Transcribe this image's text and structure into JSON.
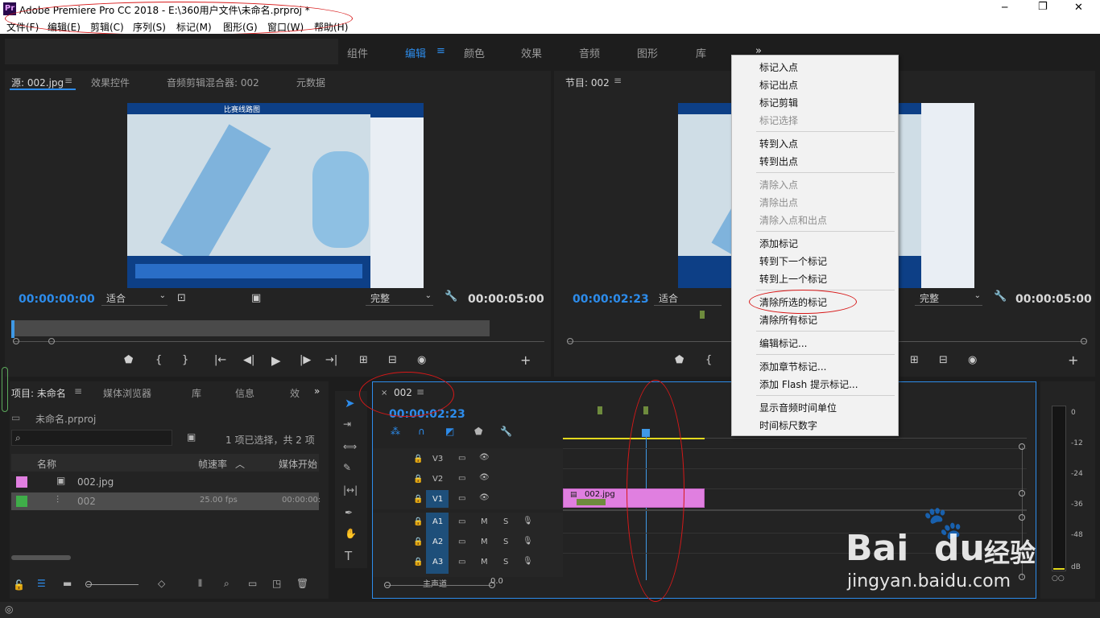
{
  "app": {
    "title": "Adobe Premiere Pro CC 2018 - E:\\360用户文件\\未命名.prproj *",
    "icon_text": "Pr"
  },
  "window_controls": {
    "minimize": "─",
    "restore": "❐",
    "close": "✕"
  },
  "menu": [
    "文件(F)",
    "编辑(E)",
    "剪辑(C)",
    "序列(S)",
    "标记(M)",
    "图形(G)",
    "窗口(W)",
    "帮助(H)"
  ],
  "workspaces": {
    "items": [
      "组件",
      "编辑",
      "颜色",
      "效果",
      "音频",
      "图形",
      "库"
    ],
    "active": "编辑",
    "more": "»"
  },
  "source_panel": {
    "tabs": [
      "源: 002.jpg",
      "效果控件",
      "音频剪辑混合器: 002",
      "元数据"
    ],
    "timecode": "00:00:00:00",
    "fit": "适合",
    "quality": "完整",
    "duration": "00:00:05:00"
  },
  "program_panel": {
    "tab": "节目: 002",
    "timecode": "00:00:02:23",
    "fit": "适合",
    "quality": "完整",
    "duration": "00:00:05:00"
  },
  "map_image": {
    "header_title": "比赛线路图"
  },
  "project_panel": {
    "tabs": [
      "项目: 未命名",
      "媒体浏览器",
      "库",
      "信息",
      "效"
    ],
    "file": "未命名.prproj",
    "selection": "1 项已选择，共 2 项",
    "columns": [
      "名称",
      "帧速率",
      "媒体开始"
    ],
    "items": [
      {
        "name": "002.jpg",
        "fps": "",
        "start": "",
        "color": "#e07fe0"
      },
      {
        "name": "002",
        "fps": "25.00 fps",
        "start": "00:00:00:",
        "color": "#3fae49"
      }
    ]
  },
  "timeline": {
    "tab": "002",
    "timecode": "00:00:02:23",
    "video_tracks": [
      "V3",
      "V2",
      "V1"
    ],
    "audio_tracks": [
      "A1",
      "A2",
      "A3"
    ],
    "master": "主声道",
    "master_value": "0.0",
    "clip_name": "002.jpg",
    "track_buttons": {
      "mute": "M",
      "solo": "S"
    }
  },
  "meter": {
    "labels": [
      "0",
      "-12",
      "-24",
      "-36",
      "-48",
      "dB"
    ]
  },
  "context_menu": {
    "items": [
      {
        "label": "标记入点",
        "enabled": true
      },
      {
        "label": "标记出点",
        "enabled": true
      },
      {
        "label": "标记剪辑",
        "enabled": true
      },
      {
        "label": "标记选择",
        "enabled": false
      },
      {
        "label": "转到入点",
        "enabled": true
      },
      {
        "label": "转到出点",
        "enabled": true
      },
      {
        "label": "清除入点",
        "enabled": false
      },
      {
        "label": "清除出点",
        "enabled": false
      },
      {
        "label": "清除入点和出点",
        "enabled": false
      },
      {
        "label": "添加标记",
        "enabled": true
      },
      {
        "label": "转到下一个标记",
        "enabled": true
      },
      {
        "label": "转到上一个标记",
        "enabled": true
      },
      {
        "label": "清除所选的标记",
        "enabled": true
      },
      {
        "label": "清除所有标记",
        "enabled": true
      },
      {
        "label": "编辑标记...",
        "enabled": true
      },
      {
        "label": "添加章节标记...",
        "enabled": true
      },
      {
        "label": "添加 Flash 提示标记...",
        "enabled": true
      },
      {
        "label": "显示音频时间单位",
        "enabled": true
      },
      {
        "label": "时间标尺数字",
        "enabled": true
      }
    ]
  },
  "watermark": {
    "brand": "Bai",
    "brand2": "du",
    "cn": "经验",
    "url": "jingyan.baidu.com"
  },
  "colors": {
    "accent": "#2d8ceb",
    "clip": "#e07fe0",
    "marker": "#6e8b3d",
    "playhead": "#3f99e6",
    "annotation": "#d71818"
  }
}
